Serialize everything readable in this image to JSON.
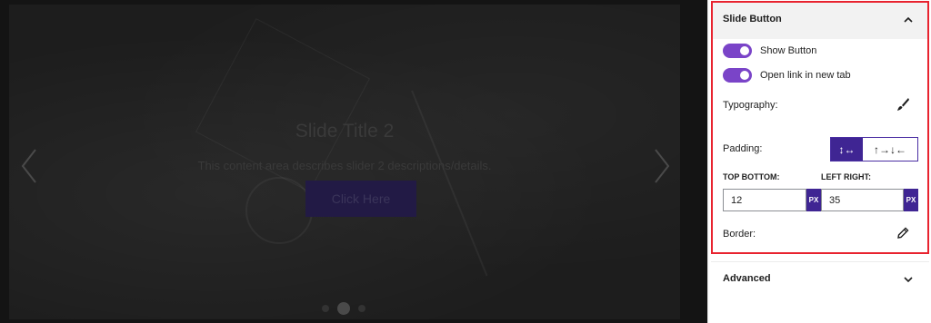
{
  "slider": {
    "title": "Slide Title 2",
    "description": "This content area describes slider 2 descriptions/details.",
    "button_label": "Click Here",
    "active_dot": 2,
    "dot_count": 3
  },
  "panel": {
    "section_title": "Slide Button",
    "show_button_label": "Show Button",
    "open_link_label": "Open link in new tab",
    "typography_label": "Typography:",
    "padding_label": "Padding:",
    "padding_mode_linked": "↕↔",
    "padding_mode_individual": "↑→↓←",
    "top_bottom_label": "TOP BOTTOM:",
    "left_right_label": "LEFT RIGHT:",
    "top_bottom_value": "12",
    "left_right_value": "35",
    "unit_label": "PX",
    "border_label": "Border:",
    "advanced_label": "Advanced"
  },
  "colors": {
    "accent": "#7a44c8",
    "unit_bg": "#3f2593",
    "highlight_border": "#e8232f"
  }
}
